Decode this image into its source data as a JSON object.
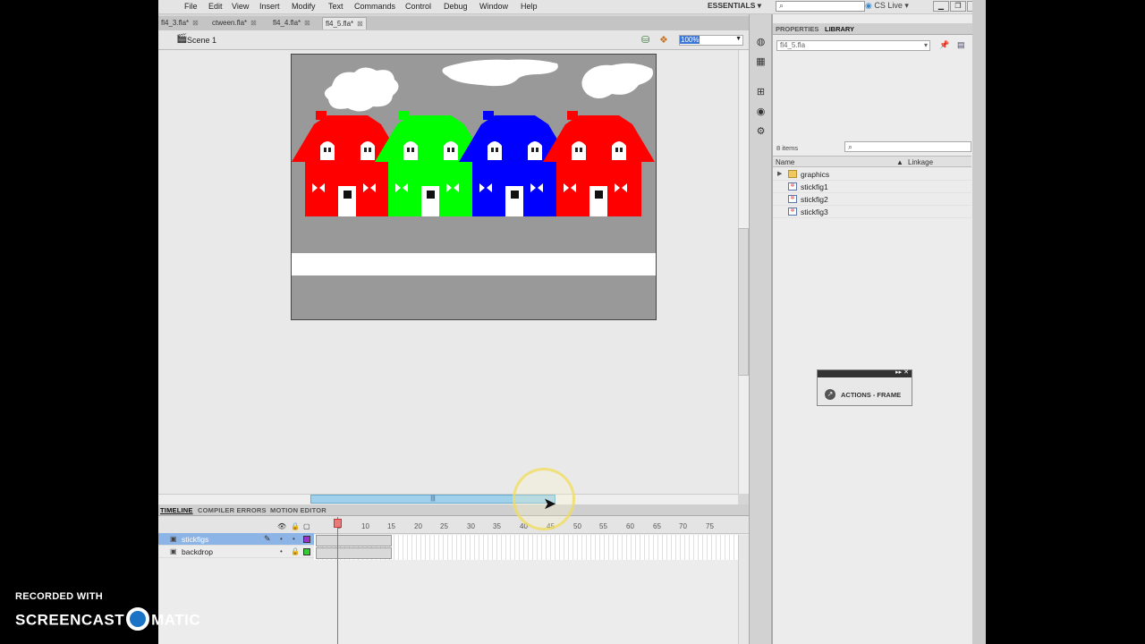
{
  "menu": [
    "File",
    "Edit",
    "View",
    "Insert",
    "Modify",
    "Text",
    "Commands",
    "Control",
    "Debug",
    "Window",
    "Help"
  ],
  "workspace": "ESSENTIALS",
  "search_placeholder": "",
  "cs_live": "CS Live",
  "doc_tabs": [
    "fl4_3.fla*",
    "ctween.fla*",
    "fl4_4.fla*",
    "fl4_5.fla*"
  ],
  "active_doc_tab": "fl4_5.fla*",
  "scene": "Scene 1",
  "zoom": "100%",
  "stage": {
    "sky_color": "#999999",
    "road_color": "#ffffff",
    "house_colors": [
      "#ff0000",
      "#00ff00",
      "#0000ff",
      "#ff0000"
    ]
  },
  "timeline": {
    "tabs": [
      "TIMELINE",
      "COMPILER ERRORS",
      "MOTION EDITOR"
    ],
    "frame_numbers": [
      "5",
      "10",
      "15",
      "20",
      "25",
      "30",
      "35",
      "40",
      "45",
      "50",
      "55",
      "60",
      "65",
      "70",
      "75"
    ],
    "current_frame": 5,
    "layers": [
      {
        "name": "stickfigs",
        "selected": true,
        "color": "#9933cc"
      },
      {
        "name": "backdrop",
        "selected": false,
        "color": "#33cc33"
      }
    ]
  },
  "library": {
    "tabs": [
      "PROPERTIES",
      "LIBRARY"
    ],
    "document": "fl4_5.fla",
    "item_count": "8 items",
    "columns": [
      "Name",
      "Linkage"
    ],
    "items": [
      {
        "name": "graphics",
        "type": "folder"
      },
      {
        "name": "stickfig1",
        "type": "symbol"
      },
      {
        "name": "stickfig2",
        "type": "symbol"
      },
      {
        "name": "stickfig3",
        "type": "symbol"
      }
    ]
  },
  "actions_panel": "ACTIONS - FRAME",
  "watermark": {
    "line1": "RECORDED WITH",
    "line2a": "SCREENCAST",
    "line2b": "MATIC"
  }
}
